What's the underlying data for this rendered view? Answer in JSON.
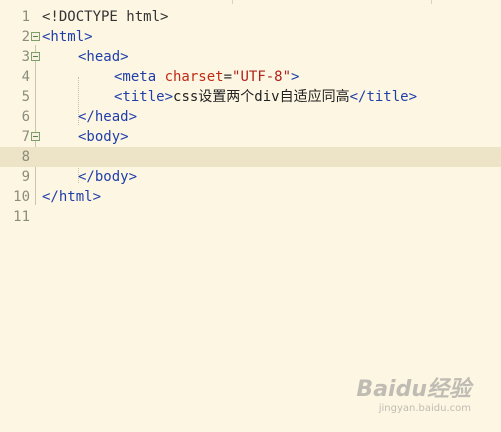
{
  "gutter": {
    "line_numbers": [
      "1",
      "2",
      "3",
      "4",
      "5",
      "6",
      "7",
      "8",
      "9",
      "10",
      "11"
    ]
  },
  "code": {
    "l1": "<!DOCTYPE html>",
    "l2": "<html>",
    "l3": "<head>",
    "l4_open": "<meta ",
    "l4_attr": "charset",
    "l4_eq": "=",
    "l4_val": "\"UTF-8\"",
    "l4_close": ">",
    "l5_open": "<title>",
    "l5_text": "css设置两个div自适应同高",
    "l5_close": "</title>",
    "l6": "</head>",
    "l7": "<body>",
    "l9": "</body>",
    "l10": "</html>"
  },
  "watermark": {
    "main": "Baidu经验",
    "sub": "jingyan.baidu.com"
  }
}
